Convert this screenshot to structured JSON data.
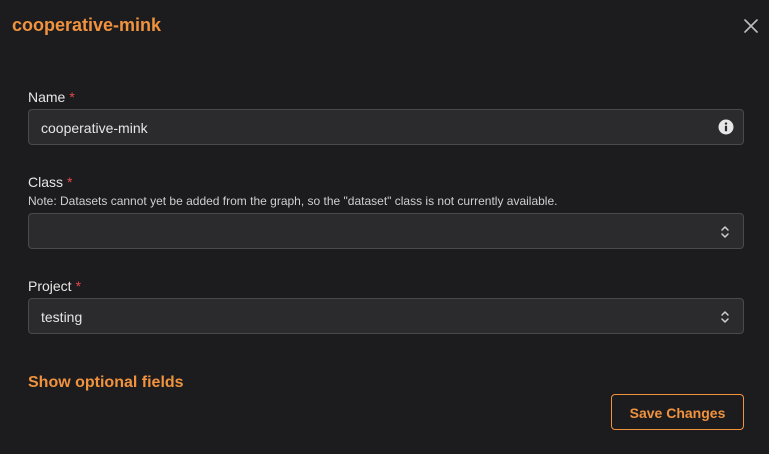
{
  "dialog": {
    "title": "cooperative-mink"
  },
  "fields": {
    "name": {
      "label": "Name",
      "required_marker": "*",
      "value": "cooperative-mink"
    },
    "class": {
      "label": "Class",
      "required_marker": "*",
      "note": "Note: Datasets cannot yet be added from the graph, so the \"dataset\" class is not currently available.",
      "value": ""
    },
    "project": {
      "label": "Project",
      "required_marker": "*",
      "value": "testing"
    }
  },
  "actions": {
    "show_optional": "Show optional fields",
    "save": "Save Changes"
  },
  "icons": {
    "close": "close-icon",
    "info": "info-icon",
    "select": "chevrons-up-down-icon"
  },
  "colors": {
    "accent": "#f0923e",
    "required": "#e5484d",
    "background": "#1c1c1e",
    "input_background": "#2b2b2e"
  }
}
